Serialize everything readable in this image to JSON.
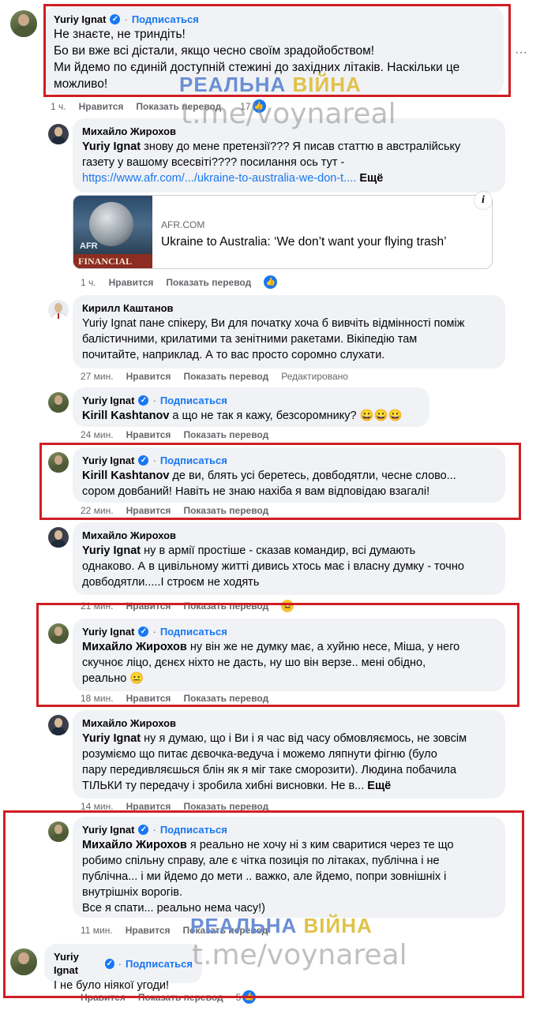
{
  "watermark": {
    "part1": "РЕАЛЬНА",
    "part2": "ВІЙНА",
    "url": "t.me/voynareal"
  },
  "labels": {
    "like": "Нравится",
    "translate": "Показать перевод",
    "subscribe": "Подписаться",
    "more": "Ещё",
    "edited": "Редактировано"
  },
  "comments": {
    "c1": {
      "author": "Yuriy Ignat",
      "time": "1 ч.",
      "lines": [
        "Не знаєте, не триндіть!",
        "Бо ви вже всі дістали, якщо чесно своїм зрадойобством!",
        "Ми йдемо по єдиній доступній стежині до західних літаків. Наскільки це",
        "можливо!"
      ],
      "reactions": "17",
      "dots": "···"
    },
    "c2": {
      "author": "Михайло Жирохов",
      "tag": "Yuriy Ignat",
      "line1": " знову до мене претензії??? Я писав статтю в австралійську",
      "line2": "газету у вашому всесвіті???? посилання ось тут -",
      "link": "https://www.afr.com/.../ukraine-to-australia-we-don-t....",
      "time": "1 ч.",
      "card": {
        "domain": "AFR.COM",
        "title": "Ukraine to Australia: ‘We don’t want your flying trash’",
        "thumb_text": "FINANCIAL",
        "thumb_label": "AFR"
      }
    },
    "c3": {
      "author": "Кирилл Каштанов",
      "tag": "Yuriy Ignat",
      "line1": " пане спікеру, Ви для початку хоча б вивчіть відмінності поміж",
      "line2": "балістичними, крилатими та зенітними ракетами. Вікіпедію там",
      "line3": "почитайте, наприклад. А то вас просто соромно слухати.",
      "time": "27 мин."
    },
    "c4": {
      "author": "Yuriy Ignat",
      "tag": "Kirill Kashtanov",
      "text": " а що не так я кажу, безсоромнику? 😀😀😀",
      "time": "24 мин."
    },
    "c5": {
      "author": "Yuriy Ignat",
      "tag": "Kirill Kashtanov",
      "line1": " де ви, блять усі беретесь, довбодятли, чесне слово...",
      "line2": "сором довбаний! Навіть не знаю нахіба я вам відповідаю взагалі!",
      "time": "22 мин."
    },
    "c6": {
      "author": "Михайло Жирохов",
      "tag": "Yuriy Ignat",
      "line1": " ну в армії простіше - сказав командир, всі думають",
      "line2": "однаково. А в цивільному житті дивись хтось має і власну думку - точно",
      "line3": "довбодятли.....І строєм не ходять",
      "time": "21 мин."
    },
    "c7": {
      "author": "Yuriy Ignat",
      "tag": "Михайло Жирохов",
      "line1": " ну він же не думку має, а хуйню несе, Міша, у него",
      "line2": "скучноє ліцо, дєнєх ніхто не дасть, ну шо він верзе.. мені обідно,",
      "line3": "реально 😐",
      "time": "18 мин."
    },
    "c8": {
      "author": "Михайло Жирохов",
      "tag": "Yuriy Ignat",
      "line1": " ну я думаю, що і Ви і я час від часу обмовляємось, не зовсім",
      "line2": "розуміємо що питає дєвочка-ведуча і можемо ляпнути фігню (було",
      "line3": "пару передивляєшься блін як я міг таке сморозити). Людина побачила",
      "line4": "ТІЛЬКИ ту передачу і зробила хибні висновки. Не в...",
      "time": "14 мин."
    },
    "c9": {
      "author": "Yuriy Ignat",
      "tag": "Михайло Жирохов",
      "line1": " я реально не хочу ні з ким сваритися через те що",
      "line2": "робимо спільну справу, але є чітка позиція по літаках, публічна і не",
      "line3": "публічна... і ми йдемо до мети .. важко, але йдемо, попри зовнішніх і",
      "line4": "внутрішніх ворогів.",
      "line5": "Все я спати... реально нема часу!)",
      "time": "11 мин."
    },
    "c10": {
      "author": "Yuriy Ignat",
      "text": "І не було ніякої угоди!",
      "reactions": "5"
    }
  }
}
